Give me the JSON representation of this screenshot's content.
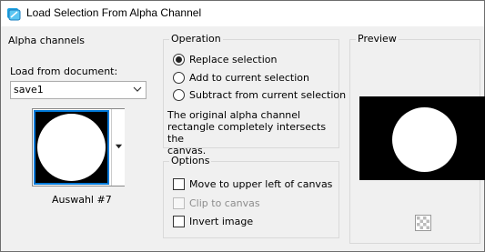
{
  "window": {
    "title": "Load Selection From Alpha Channel",
    "icon": "selection-app-icon"
  },
  "alpha_channels": {
    "group_title": "Alpha channels",
    "load_from_label": "Load from document:",
    "document_value": "save1",
    "selected_channel_name": "Auswahl #7"
  },
  "operation": {
    "group_title": "Operation",
    "options": [
      {
        "label": "Replace selection",
        "checked": true
      },
      {
        "label": "Add to current selection",
        "checked": false
      },
      {
        "label": "Subtract from current selection",
        "checked": false
      }
    ],
    "description": [
      "The original alpha channel",
      "rectangle completely intersects the",
      "canvas."
    ]
  },
  "options": {
    "group_title": "Options",
    "move_label": "Move to upper left of canvas",
    "clip_label": "Clip to canvas",
    "invert_label": "Invert image"
  },
  "preview": {
    "group_title": "Preview"
  },
  "colors": {
    "accent": "#0078d7",
    "group_border": "#d9d9d9",
    "disabled": "#8d8d8d"
  }
}
